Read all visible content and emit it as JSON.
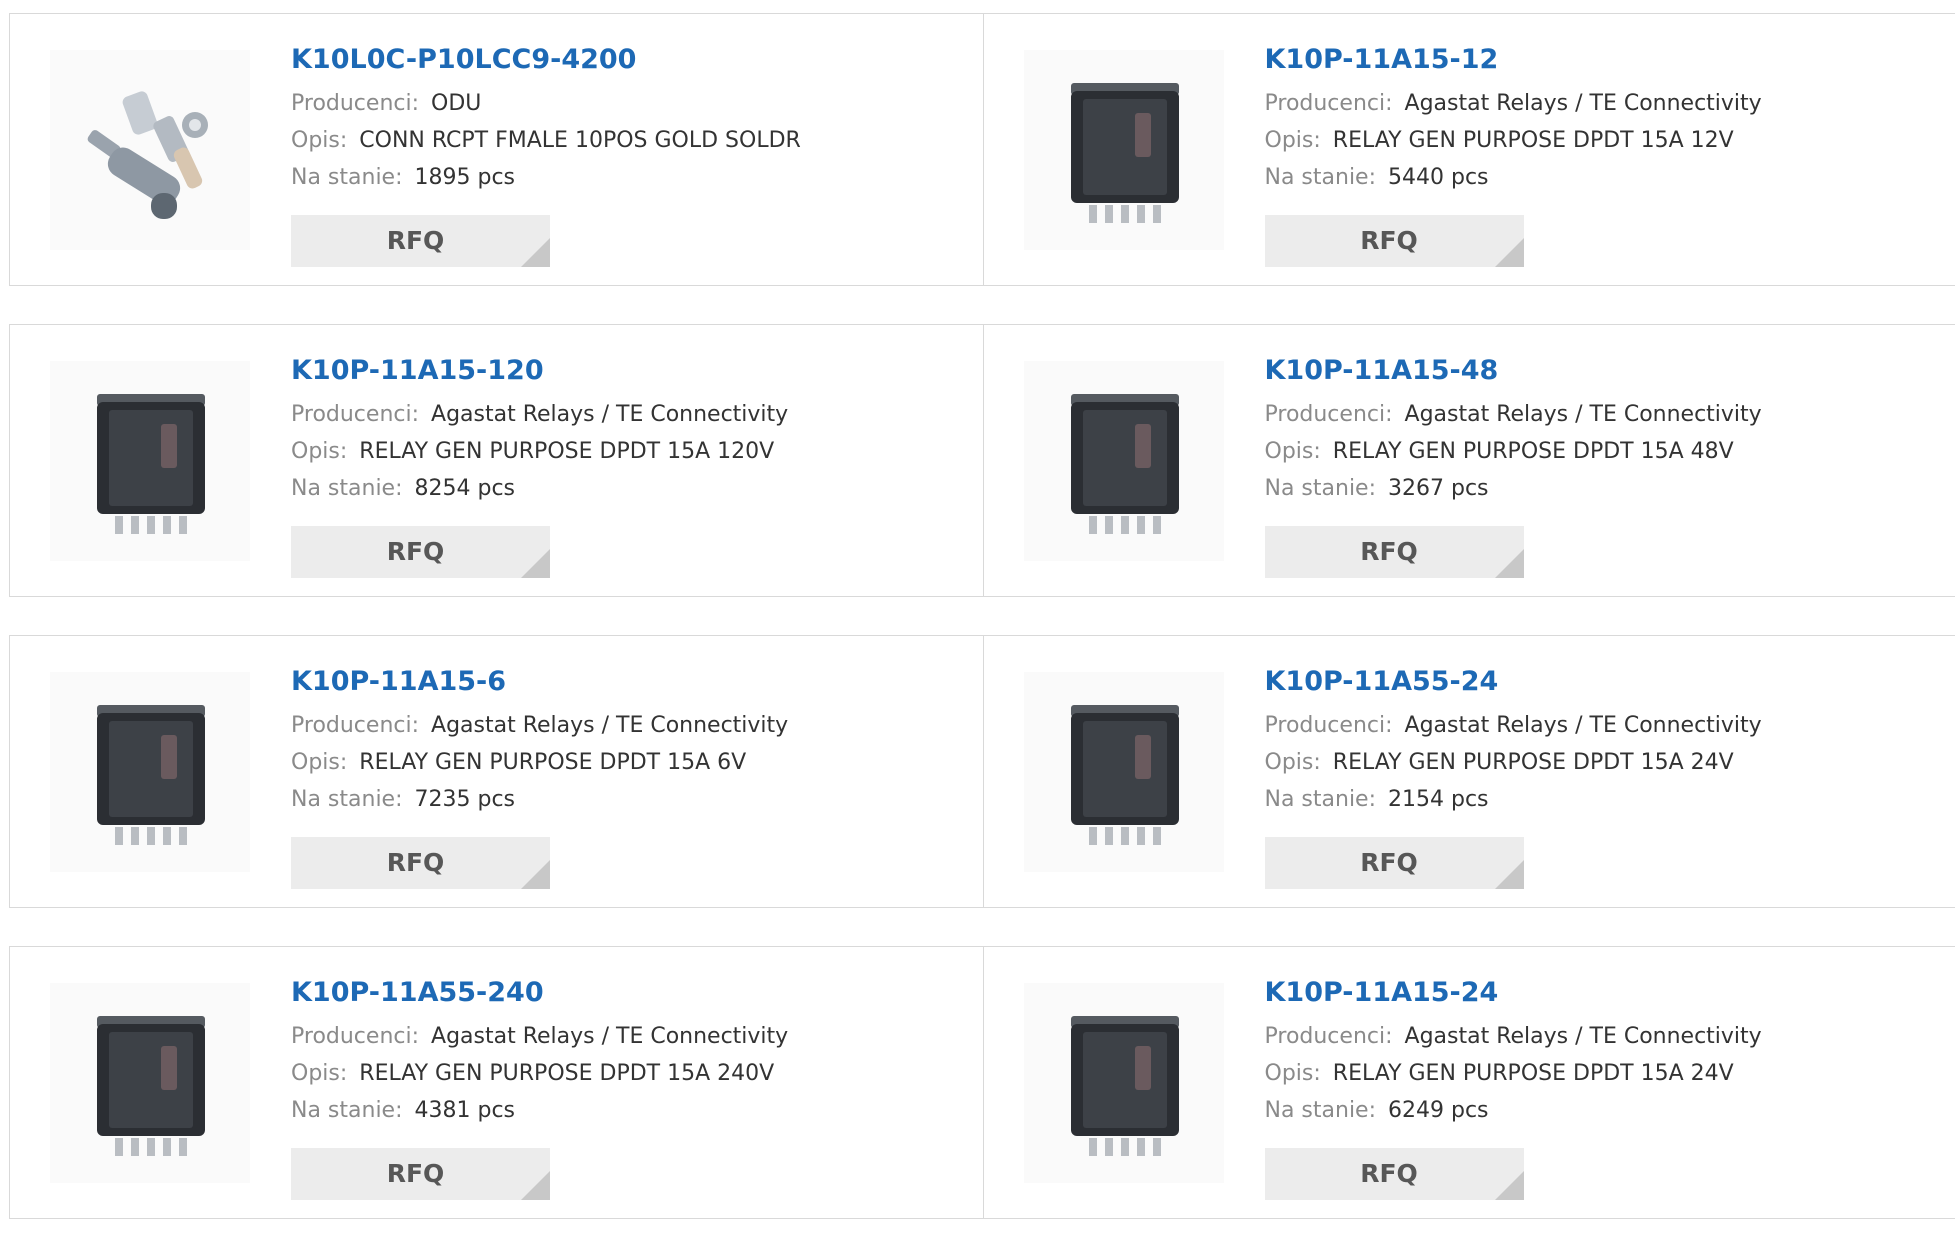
{
  "labels": {
    "manufacturer": "Producenci:",
    "description": "Opis:",
    "stock": "Na stanie:",
    "rfq": "RFQ"
  },
  "colors": {
    "title": "#1d69b5",
    "border": "#d9d9d9",
    "button_bg": "#ececec"
  },
  "products": [
    {
      "part": "K10L0C-P10LCC9-4200",
      "manufacturer": "ODU",
      "description": "CONN RCPT FMALE 10POS GOLD SOLDR",
      "stock": "1895 pcs",
      "image": "connector-kit-image"
    },
    {
      "part": "K10P-11A15-12",
      "manufacturer": "Agastat Relays / TE Connectivity",
      "description": "RELAY GEN PURPOSE DPDT 15A 12V",
      "stock": "5440 pcs",
      "image": "relay-image"
    },
    {
      "part": "K10P-11A15-120",
      "manufacturer": "Agastat Relays / TE Connectivity",
      "description": "RELAY GEN PURPOSE DPDT 15A 120V",
      "stock": "8254 pcs",
      "image": "relay-image"
    },
    {
      "part": "K10P-11A15-48",
      "manufacturer": "Agastat Relays / TE Connectivity",
      "description": "RELAY GEN PURPOSE DPDT 15A 48V",
      "stock": "3267 pcs",
      "image": "relay-image"
    },
    {
      "part": "K10P-11A15-6",
      "manufacturer": "Agastat Relays / TE Connectivity",
      "description": "RELAY GEN PURPOSE DPDT 15A 6V",
      "stock": "7235 pcs",
      "image": "relay-image"
    },
    {
      "part": "K10P-11A55-24",
      "manufacturer": "Agastat Relays / TE Connectivity",
      "description": "RELAY GEN PURPOSE DPDT 15A 24V",
      "stock": "2154 pcs",
      "image": "relay-image"
    },
    {
      "part": "K10P-11A55-240",
      "manufacturer": "Agastat Relays / TE Connectivity",
      "description": "RELAY GEN PURPOSE DPDT 15A 240V",
      "stock": "4381 pcs",
      "image": "relay-image"
    },
    {
      "part": "K10P-11A15-24",
      "manufacturer": "Agastat Relays / TE Connectivity",
      "description": "RELAY GEN PURPOSE DPDT 15A 24V",
      "stock": "6249 pcs",
      "image": "relay-image"
    }
  ]
}
